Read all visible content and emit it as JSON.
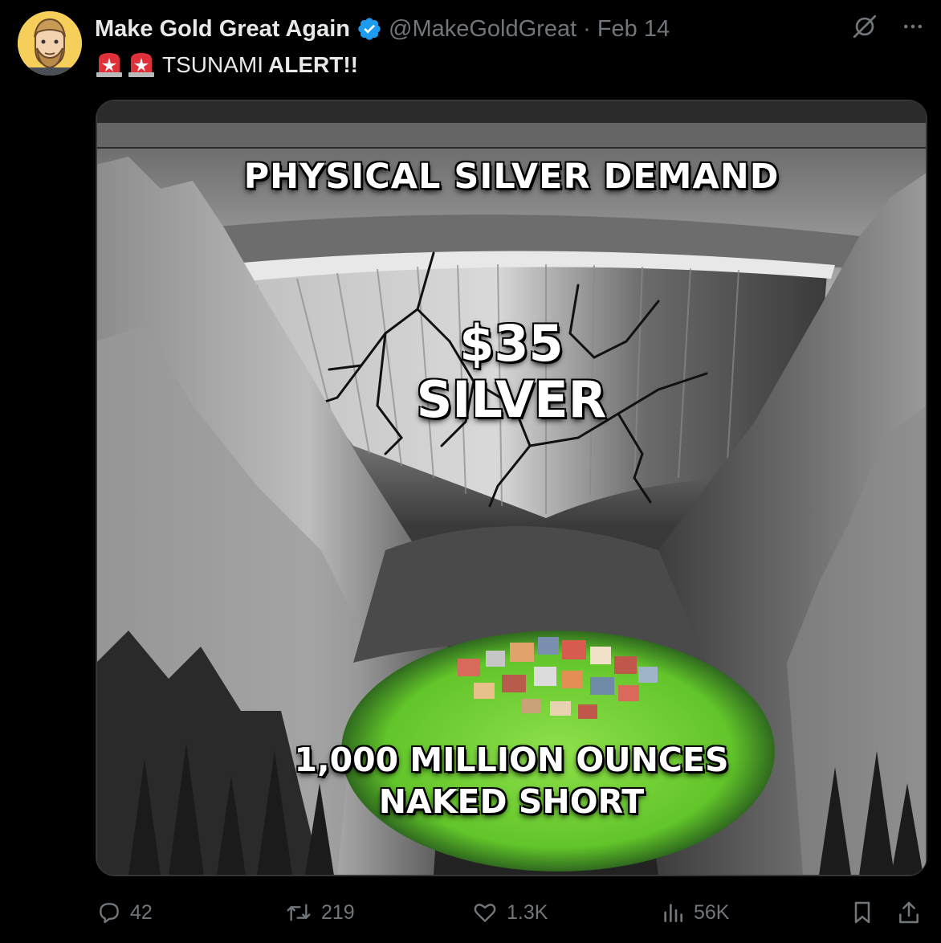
{
  "post": {
    "author_name": "Make Gold Great Again",
    "verified_icon": "verified-badge-icon",
    "handle": "@MakeGoldGreat",
    "separator": "·",
    "date": "Feb 14",
    "text_emoji": "rotating-light-emoji",
    "text_plain": "TSUNAMI",
    "text_bold": "ALERT!!"
  },
  "image": {
    "headline": "PHYSICAL SILVER DEMAND",
    "dam_label_line1": "$35",
    "dam_label_line2": "SILVER",
    "bottom_line1": "1,000 MILLION OUNCES",
    "bottom_line2": "NAKED SHORT"
  },
  "actions": {
    "replies": "42",
    "reposts": "219",
    "likes": "1.3K",
    "views": "56K"
  },
  "colors": {
    "verified": "#1d9bf0",
    "avatar_bg": "#f6cf5a",
    "muted": "#71767b",
    "meadow": "#7bd43a"
  }
}
